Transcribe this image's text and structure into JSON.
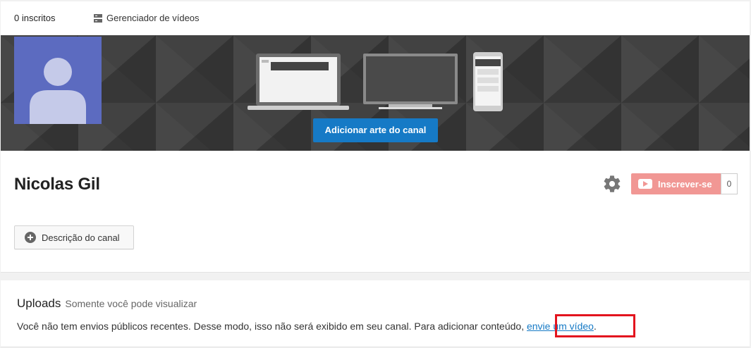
{
  "topbar": {
    "subscribers": "0 inscritos",
    "video_manager": "Gerenciador de vídeos"
  },
  "banner": {
    "add_art_button": "Adicionar arte do canal"
  },
  "channel": {
    "name": "Nicolas Gil",
    "subscribe_label": "Inscrever-se",
    "subscriber_count": "0",
    "description_button": "Descrição do canal"
  },
  "uploads": {
    "title": "Uploads",
    "visibility_hint": "Somente você pode visualizar",
    "message": "Você não tem envios públicos recentes. Desse modo, isso não será exibido em seu canal. Para adicionar conteúdo, ",
    "upload_link": "envie um vídeo",
    "message_end": "."
  },
  "colors": {
    "accent_blue": "#167ac6",
    "subscribe_red": "#f19794",
    "avatar_bg": "#5c6bc0",
    "highlight": "#e3141e"
  }
}
